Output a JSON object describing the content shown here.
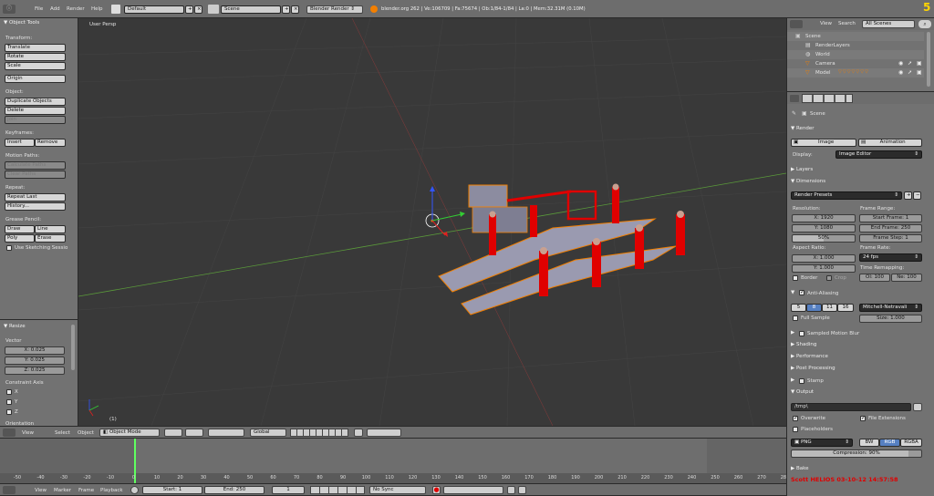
{
  "info_header": {
    "menus": [
      "File",
      "Add",
      "Render",
      "Help"
    ],
    "layout": "Default",
    "scene": "Scene",
    "engine": "Blender Render",
    "stats": "blender.org 262 | Ve:106709 | Fa:75674 | Ob:1/84-1/84 | La:0 | Mem:32.31M (0.10M)",
    "badge": "5"
  },
  "tools": {
    "title": "Object Tools",
    "transform": "Transform:",
    "translate": "Translate",
    "rotate": "Rotate",
    "scale": "Scale",
    "origin": "Origin",
    "object": "Object:",
    "duplicate": "Duplicate Objects",
    "delete": "Delete",
    "join": "Join",
    "keyframes": "Keyframes:",
    "insert": "Insert",
    "remove": "Remove",
    "motion_paths": "Motion Paths:",
    "calc_paths": "Calculate Paths",
    "clear_paths": "Clear Paths",
    "repeat": "Repeat:",
    "repeat_last": "Repeat Last",
    "history": "History...",
    "grease": "Grease Pencil:",
    "draw": "Draw",
    "line": "Line",
    "poly": "Poly",
    "erase": "Erase",
    "sketching": "Use Sketching Sessio"
  },
  "resize": {
    "title": "Resize",
    "vector": "Vector",
    "vx": "X: 0.025",
    "vy": "Y: 0.025",
    "vz": "Z: 0.025",
    "constraint": "Constraint Axis",
    "x": "X",
    "y": "Y",
    "z": "Z",
    "orientation": "Orientation"
  },
  "viewport": {
    "label": "User Persp",
    "frame": "(1)"
  },
  "view_header": {
    "view": "View",
    "select": "Select",
    "object": "Object",
    "mode": "Object Mode",
    "orientation": "Global"
  },
  "outliner": {
    "view": "View",
    "search": "Search",
    "all_scenes": "All Scenes",
    "items": [
      "Scene",
      "RenderLayers",
      "World",
      "Camera",
      "Model"
    ]
  },
  "properties": {
    "scene": "Scene",
    "render": "Render",
    "image": "Image",
    "animation": "Animation",
    "display": "Display:",
    "display_val": "Image Editor",
    "layers": "Layers",
    "dimensions": "Dimensions",
    "render_presets": "Render Presets",
    "resolution": "Resolution:",
    "res_x": "X: 1920",
    "res_y": "Y: 1080",
    "res_pct": "50%",
    "frame_range": "Frame Range:",
    "start_frame": "Start Frame: 1",
    "end_frame": "End Frame: 250",
    "frame_step": "Frame Step: 1",
    "aspect": "Aspect Ratio:",
    "asp_x": "X: 1.000",
    "asp_y": "Y: 1.000",
    "frame_rate": "Frame Rate:",
    "fps": "24 fps",
    "time_remap": "Time Remapping:",
    "old": "Ol: 100",
    "new": "Ne: 100",
    "border": "Border",
    "crop": "Crop",
    "aa": "Anti-Aliasing",
    "aa_levels": [
      "5",
      "8",
      "11",
      "16"
    ],
    "aa_filter": "Mitchell-Netravali",
    "full_sample": "Full Sample",
    "size": "Size: 1.000",
    "motion_blur": "Sampled Motion Blur",
    "shading": "Shading",
    "performance": "Performance",
    "post": "Post Processing",
    "stamp": "Stamp",
    "output": "Output",
    "path": "/tmp\\",
    "overwrite": "Overwrite",
    "file_ext": "File Extensions",
    "placeholders": "Placeholders",
    "format": "PNG",
    "bw": "BW",
    "rgb": "RGB",
    "rgba": "RGBA",
    "compression": "Compression: 90%",
    "bake": "Bake",
    "stamp_text": "Scott HELIOS 03-10-12 14:57:58"
  },
  "timeline": {
    "ticks": [
      "-50",
      "-40",
      "-30",
      "-20",
      "-10",
      "0",
      "10",
      "20",
      "30",
      "40",
      "50",
      "60",
      "70",
      "80",
      "90",
      "100",
      "110",
      "120",
      "130",
      "140",
      "150",
      "160",
      "170",
      "180",
      "190",
      "200",
      "210",
      "220",
      "230",
      "240",
      "250",
      "260",
      "270",
      "280",
      "290"
    ],
    "view": "View",
    "marker": "Marker",
    "frame": "Frame",
    "playback": "Playback",
    "start": "Start: 1",
    "end": "End: 250",
    "current": "1",
    "sync": "No Sync"
  },
  "colors": {
    "header": "#6d6d6d",
    "panel": "#727272",
    "viewport": "#393939",
    "selected": "#f27f00",
    "red": "#e00000",
    "accent": "#5680c2"
  }
}
